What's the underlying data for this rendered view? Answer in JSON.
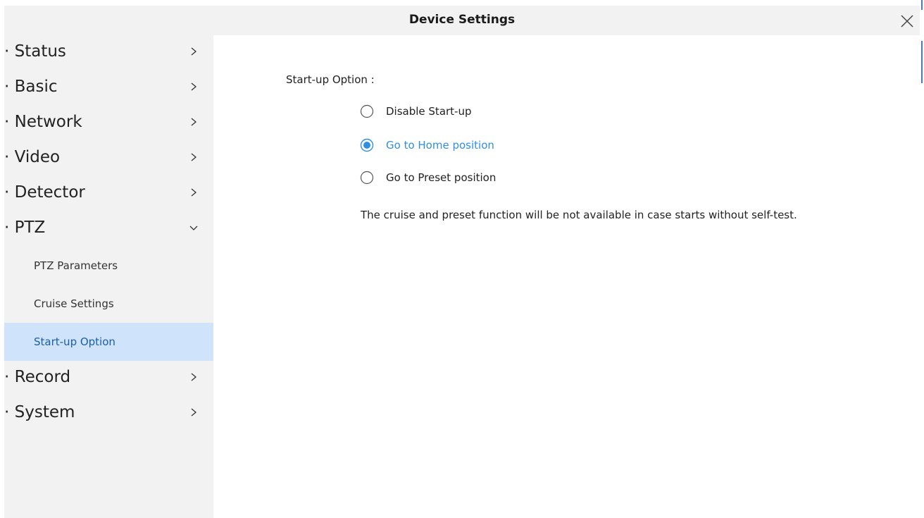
{
  "window": {
    "title": "Device Settings"
  },
  "sidebar": {
    "items": [
      {
        "label": "· Status"
      },
      {
        "label": "· Basic"
      },
      {
        "label": "· Network"
      },
      {
        "label": "· Video"
      },
      {
        "label": "· Detector"
      },
      {
        "label": "· PTZ",
        "expanded": true
      },
      {
        "label": "· Record"
      },
      {
        "label": "· System"
      }
    ],
    "ptz_subitems": [
      {
        "label": "PTZ Parameters"
      },
      {
        "label": "Cruise Settings"
      },
      {
        "label": "Start-up Option",
        "active": true
      }
    ]
  },
  "main": {
    "section_label": "Start-up Option :",
    "options": [
      {
        "label": "Disable Start-up",
        "selected": false
      },
      {
        "label": "Go to Home position",
        "selected": true
      },
      {
        "label": "Go to Preset position",
        "selected": false
      }
    ],
    "note": "The cruise and preset function will be not available in case starts without self-test."
  },
  "colors": {
    "accent": "#2f8fe5",
    "sidebar_bg": "#f2f2f2",
    "active_bg": "#cfe3fa",
    "active_text": "#1a5fa8"
  },
  "icons": {
    "close": "close-icon",
    "collapsed": "chevron-right-icon",
    "expanded": "chevron-down-icon",
    "radio": "radio-icon"
  }
}
